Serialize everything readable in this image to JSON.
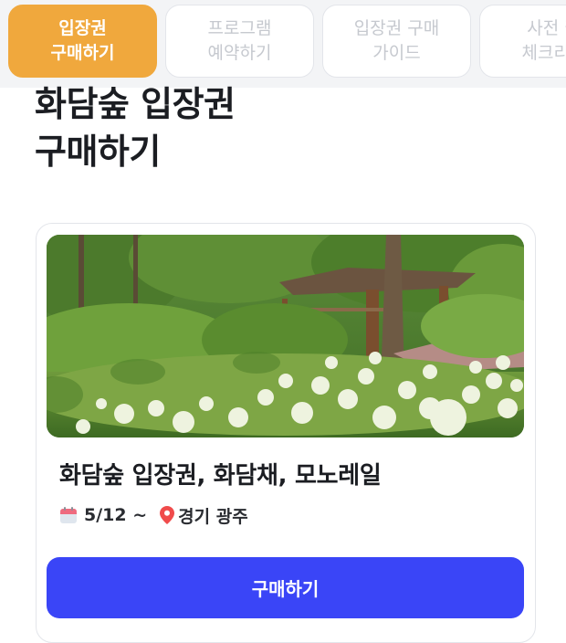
{
  "tabs": [
    {
      "line1": "입장권",
      "line2": "구매하기"
    },
    {
      "line1": "프로그램",
      "line2": "예약하기"
    },
    {
      "line1": "입장권 구매",
      "line2": "가이드"
    },
    {
      "line1": "사전 필",
      "line2": "체크리스"
    }
  ],
  "page": {
    "title_line1": "화담숲 입장권",
    "title_line2": "구매하기"
  },
  "card": {
    "title": "화담숲 입장권, 화담채, 모노레일",
    "date": "5/12 ~",
    "location": "경기 광주",
    "buy_label": "구매하기"
  },
  "colors": {
    "active_tab": "#f0a83d",
    "buy_button": "#3a45f7"
  }
}
